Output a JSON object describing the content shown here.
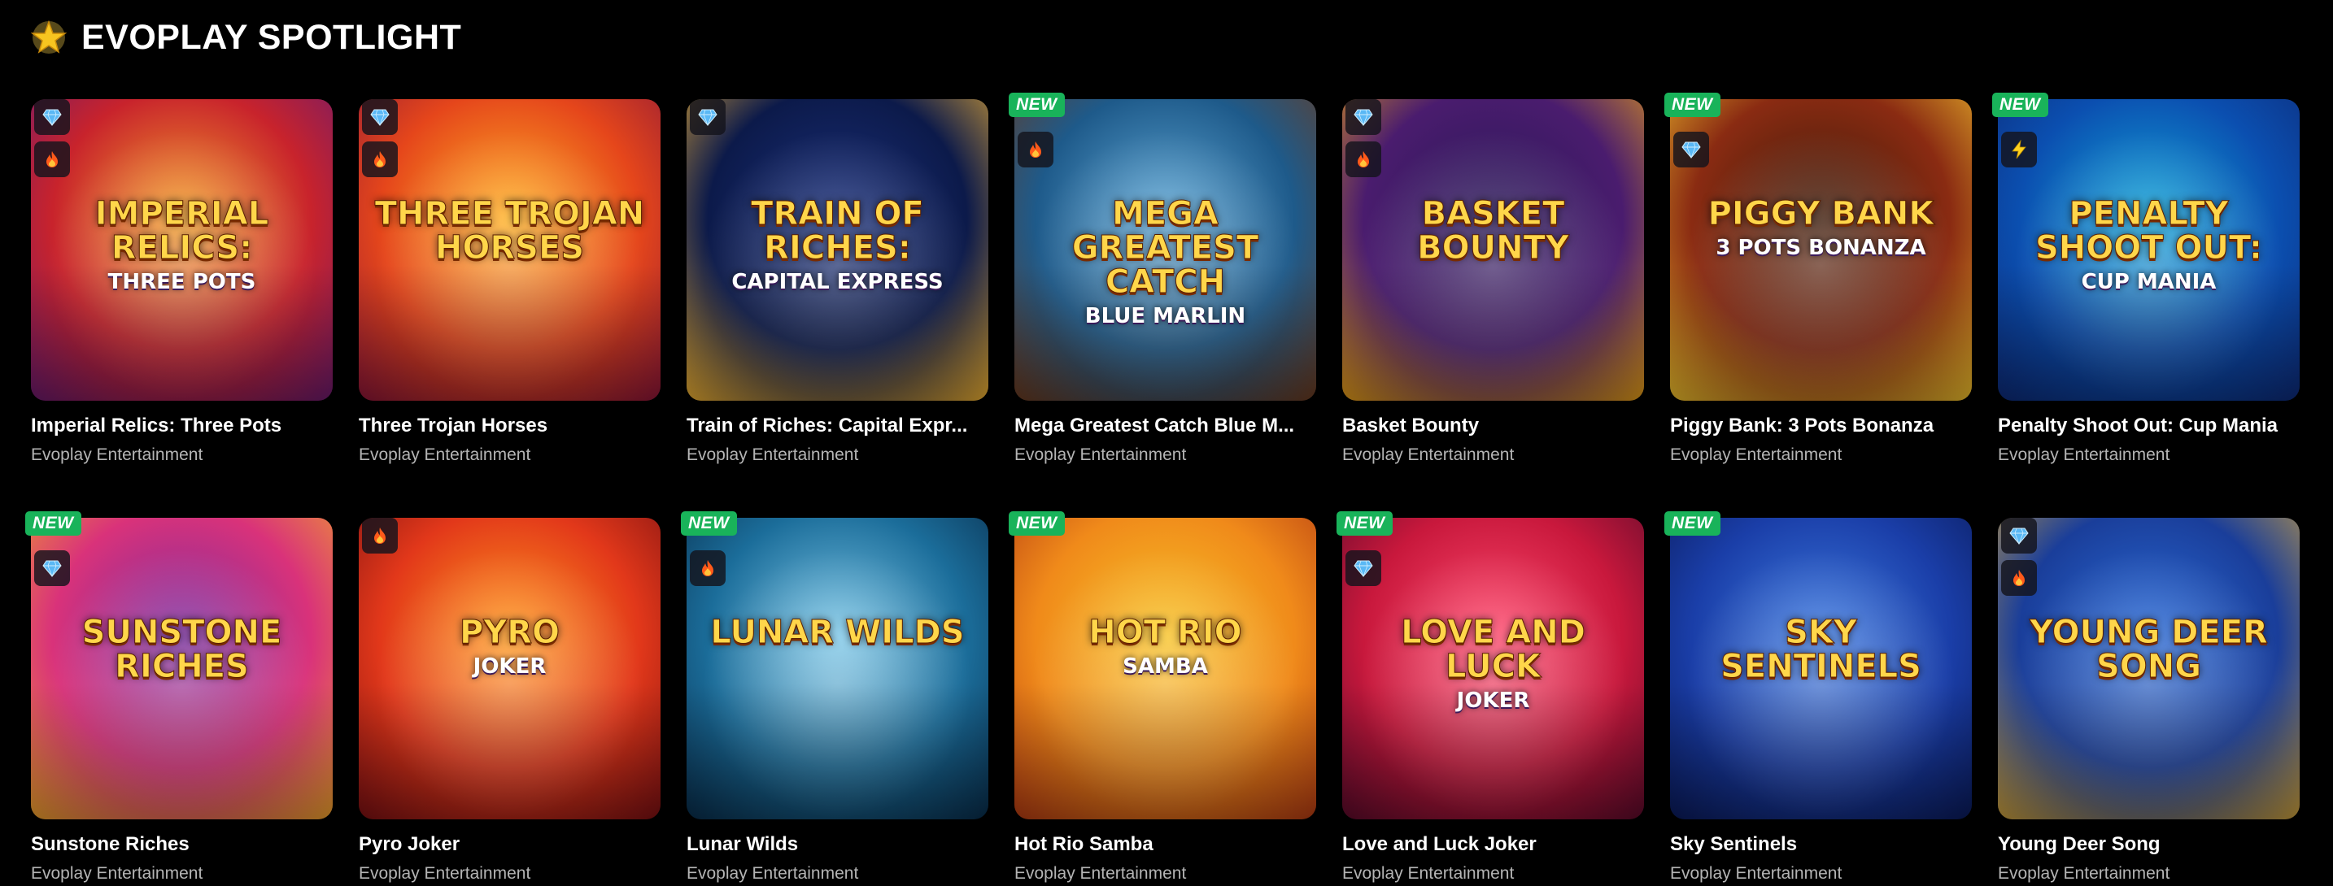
{
  "section": {
    "title": "EVOPLAY SPOTLIGHT",
    "icon": "star-icon"
  },
  "games": [
    {
      "title": "Imperial Relics: Three Pots",
      "provider": "Evoplay Entertainment",
      "new": false,
      "icons": [
        "diamond-icon",
        "fire-icon"
      ],
      "art_text": "Imperial Relics:",
      "art_sub": "Three Pots",
      "colors": [
        "#f3a22a",
        "#c8232c",
        "#6a1a6e"
      ]
    },
    {
      "title": "Three Trojan Horses",
      "provider": "Evoplay Entertainment",
      "new": false,
      "icons": [
        "diamond-icon",
        "fire-icon"
      ],
      "art_text": "Three Trojan Horses",
      "art_sub": "",
      "colors": [
        "#ffb224",
        "#e5461b",
        "#8b1538"
      ]
    },
    {
      "title": "Train of Riches: Capital Expr...",
      "provider": "Evoplay Entertainment",
      "new": false,
      "icons": [
        "diamond-icon"
      ],
      "art_text": "Train of Riches:",
      "art_sub": "Capital Express",
      "colors": [
        "#1a2f7a",
        "#0c1a4a",
        "#f2b332"
      ]
    },
    {
      "title": "Mega Greatest Catch Blue M...",
      "provider": "Evoplay Entertainment",
      "new": true,
      "new_label": "NEW",
      "icons": [
        "fire-icon"
      ],
      "art_text": "Mega Greatest Catch",
      "art_sub": "Blue Marlin",
      "colors": [
        "#5fa8d6",
        "#1e5a8a",
        "#6b3a1e"
      ]
    },
    {
      "title": "Basket Bounty",
      "provider": "Evoplay Entertainment",
      "new": false,
      "icons": [
        "diamond-icon",
        "fire-icon"
      ],
      "art_text": "Basket Bounty",
      "art_sub": "",
      "colors": [
        "#2a1858",
        "#4a1c6e",
        "#e8a016"
      ]
    },
    {
      "title": "Piggy Bank: 3 Pots Bonanza",
      "provider": "Evoplay Entertainment",
      "new": true,
      "new_label": "NEW",
      "icons": [
        "diamond-icon"
      ],
      "art_text": "Piggy Bank",
      "art_sub": "3 Pots Bonanza",
      "colors": [
        "#3c1b0a",
        "#8a2b12",
        "#f3c42d"
      ]
    },
    {
      "title": "Penalty Shoot Out: Cup Mania",
      "provider": "Evoplay Entertainment",
      "new": true,
      "new_label": "NEW",
      "icons": [
        "bolt-icon"
      ],
      "art_text": "Penalty Shoot Out:",
      "art_sub": "Cup Mania",
      "colors": [
        "#12a5d8",
        "#0b4fb0",
        "#0d2a78"
      ]
    },
    {
      "title": "Sunstone Riches",
      "provider": "Evoplay Entertainment",
      "new": true,
      "new_label": "NEW",
      "icons": [
        "diamond-icon"
      ],
      "art_text": "Sunstone Riches",
      "art_sub": "",
      "colors": [
        "#7a2da0",
        "#d9327a",
        "#f0a52a"
      ]
    },
    {
      "title": "Pyro Joker",
      "provider": "Evoplay Entertainment",
      "new": false,
      "icons": [
        "fire-icon"
      ],
      "art_text": "Pyro",
      "art_sub": "Joker",
      "colors": [
        "#ff9a1e",
        "#e2381a",
        "#7a0f12"
      ]
    },
    {
      "title": "Lunar Wilds",
      "provider": "Evoplay Entertainment",
      "new": true,
      "new_label": "NEW",
      "icons": [
        "fire-icon"
      ],
      "art_text": "Lunar Wilds",
      "art_sub": "",
      "colors": [
        "#7ec8e8",
        "#1b6d9a",
        "#082c4a"
      ]
    },
    {
      "title": "Hot Rio Samba",
      "provider": "Evoplay Entertainment",
      "new": true,
      "new_label": "NEW",
      "icons": [],
      "art_text": "Hot Rio",
      "art_sub": "Samba",
      "colors": [
        "#f7c328",
        "#f08a1a",
        "#b43a12"
      ]
    },
    {
      "title": "Love and Luck Joker",
      "provider": "Evoplay Entertainment",
      "new": true,
      "new_label": "NEW",
      "icons": [
        "diamond-icon"
      ],
      "art_text": "Love and Luck",
      "art_sub": "Joker",
      "colors": [
        "#ff4a6e",
        "#c8183c",
        "#5a0a2a"
      ]
    },
    {
      "title": "Sky Sentinels",
      "provider": "Evoplay Entertainment",
      "new": true,
      "new_label": "NEW",
      "icons": [],
      "art_text": "Sky Sentinels",
      "art_sub": "",
      "colors": [
        "#3e7ae0",
        "#1a3ea8",
        "#0a1a5a"
      ]
    },
    {
      "title": "Young Deer Song",
      "provider": "Evoplay Entertainment",
      "new": false,
      "icons": [
        "diamond-icon",
        "fire-icon"
      ],
      "art_text": "Young Deer Song",
      "art_sub": "",
      "colors": [
        "#2a6ad6",
        "#1a3e9a",
        "#d0a23a"
      ]
    }
  ]
}
